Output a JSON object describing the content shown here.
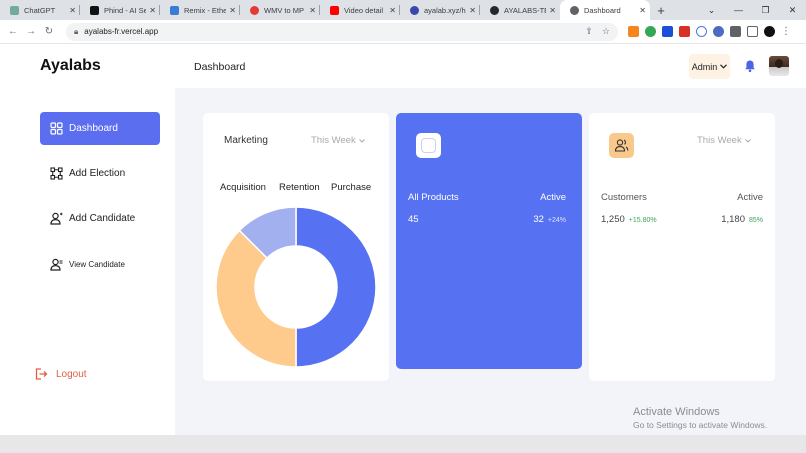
{
  "browser": {
    "tabs": [
      {
        "title": "ChatGPT",
        "color": "#74aa9c"
      },
      {
        "title": "Phind - AI Se",
        "color": "#111111"
      },
      {
        "title": "Remix - Ethe",
        "color": "#3a7bd5"
      },
      {
        "title": "WMV to MP",
        "color": "#e53935"
      },
      {
        "title": "Video detail",
        "color": "#ff0000"
      },
      {
        "title": "ayalab.xyz/h",
        "color": "#3949ab"
      },
      {
        "title": "AYALABS-TE",
        "color": "#24292e"
      },
      {
        "title": "Dashboard",
        "color": "#5f6368"
      }
    ],
    "url": "ayalabs-fr.vercel.app"
  },
  "app": {
    "brand": "Ayalabs",
    "header_title": "Dashboard",
    "admin_label": "Admin",
    "accent": "#5b6ef0"
  },
  "sidebar": {
    "items": [
      {
        "label": "Dashboard",
        "icon": "grid-icon",
        "active": true
      },
      {
        "label": "Add Election",
        "icon": "election-icon"
      },
      {
        "label": "Add Candidate",
        "icon": "user-icon"
      },
      {
        "label": "View Candidate",
        "icon": "user-icon"
      }
    ],
    "logout": "Logout"
  },
  "marketing": {
    "title": "Marketing",
    "period": "This Week",
    "legend": [
      "Acquisition",
      "Retention",
      "Purchase"
    ]
  },
  "products": {
    "label": "All Products",
    "status": "Active",
    "count": "45",
    "active_count": "32",
    "growth": "+24%"
  },
  "customers": {
    "period": "This Week",
    "label": "Customers",
    "status": "Active",
    "count": "1,250",
    "growth": "+15.80%",
    "active_count": "1,180",
    "active_pct": "85%"
  },
  "chart_data": {
    "type": "pie",
    "categories": [
      "Acquisition",
      "Retention",
      "Purchase"
    ],
    "values": [
      50,
      37.5,
      12.5
    ],
    "colors": [
      "#5672f2",
      "#fecb8d",
      "#a3b0f0"
    ]
  },
  "watermark": {
    "line1": "Activate Windows",
    "line2": "Go to Settings to activate Windows."
  }
}
